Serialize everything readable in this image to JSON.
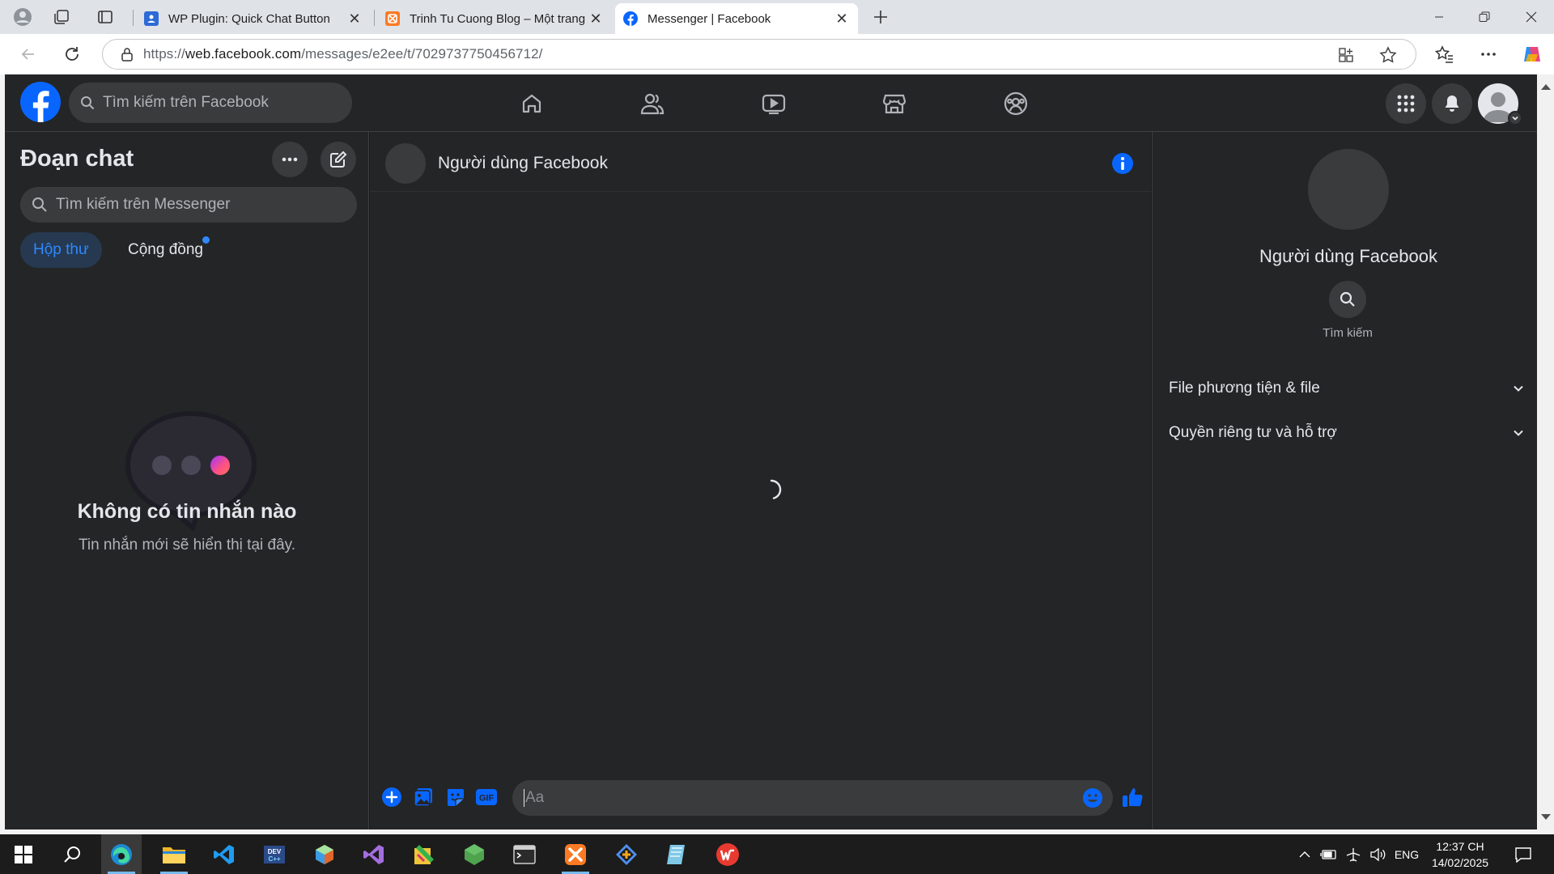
{
  "browser": {
    "tabs": [
      {
        "title": "WP Plugin: Quick Chat Button",
        "icon": "person-card-icon"
      },
      {
        "title": "Trinh Tu Cuong Blog – Một trang",
        "icon": "xampp-icon"
      },
      {
        "title": "Messenger | Facebook",
        "icon": "facebook-icon",
        "active": true
      }
    ],
    "url_prefix": "https://",
    "url_host": "web.facebook.com",
    "url_path": "/messages/e2ee/t/7029737750456712/"
  },
  "facebook": {
    "search_placeholder": "Tìm kiếm trên Facebook",
    "nav": [
      "home-icon",
      "friends-icon",
      "watch-icon",
      "marketplace-icon",
      "groups-icon"
    ]
  },
  "chats": {
    "title": "Đoạn chat",
    "search_placeholder": "Tìm kiếm trên Messenger",
    "tabs": {
      "inbox": "Hộp thư",
      "community": "Cộng đồng"
    },
    "empty_title": "Không có tin nhắn nào",
    "empty_subtitle": "Tin nhắn mới sẽ hiển thị tại đây."
  },
  "conversation": {
    "name": "Người dùng Facebook",
    "composer_placeholder": "Aa",
    "gif_label": "GIF"
  },
  "details": {
    "name": "Người dùng Facebook",
    "search_label": "Tìm kiếm",
    "sections": [
      "File phương tiện & file",
      "Quyền riêng tư và hỗ trợ"
    ]
  },
  "taskbar": {
    "language": "ENG",
    "time": "12:37 CH",
    "date": "14/02/2025"
  },
  "colors": {
    "accent": "#0866ff",
    "bg_dark": "#242526"
  }
}
